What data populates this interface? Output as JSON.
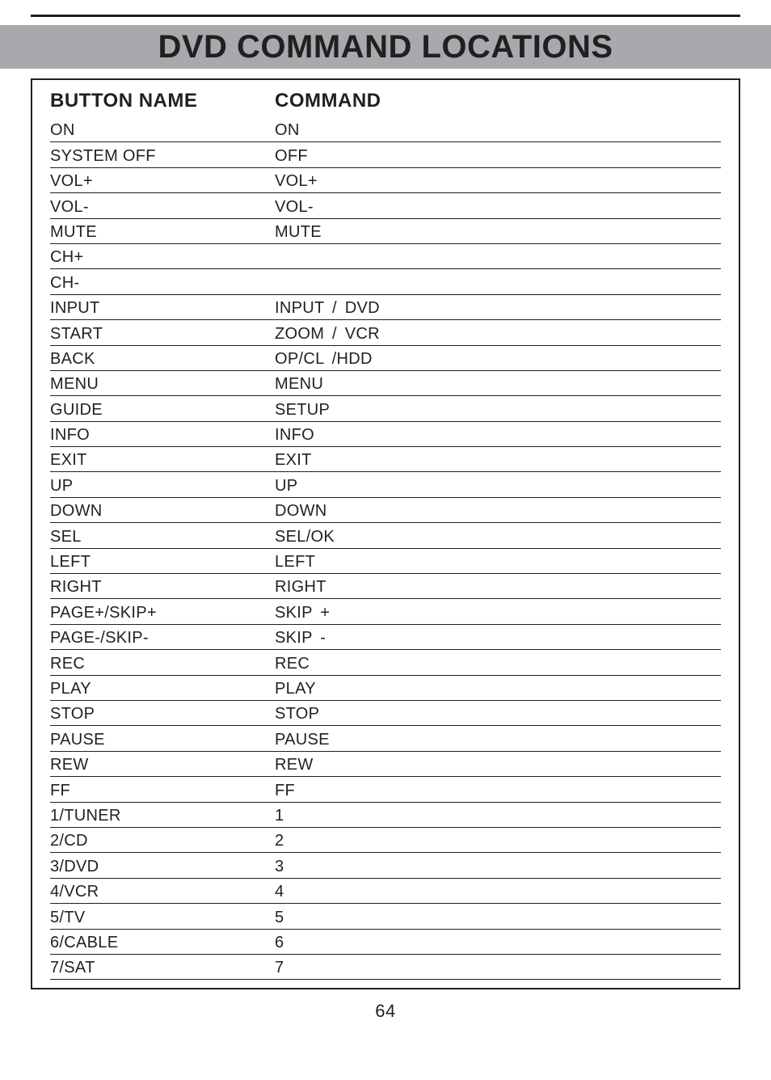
{
  "title": "DVD COMMAND LOCATIONS",
  "columns": {
    "name": "BUTTON NAME",
    "command": "COMMAND"
  },
  "rows": [
    {
      "name": "ON",
      "command": "ON"
    },
    {
      "name": "SYSTEM OFF",
      "command": "OFF"
    },
    {
      "name": "VOL+",
      "command": "VOL+"
    },
    {
      "name": "VOL-",
      "command": "VOL-"
    },
    {
      "name": "MUTE",
      "command": "MUTE"
    },
    {
      "name": "CH+",
      "command": ""
    },
    {
      "name": "CH-",
      "command": ""
    },
    {
      "name": "INPUT",
      "command": "INPUT  / DVD"
    },
    {
      "name": "START",
      "command": "ZOOM  / VCR"
    },
    {
      "name": "BACK",
      "command": "OP/CL  /HDD"
    },
    {
      "name": "MENU",
      "command": "MENU"
    },
    {
      "name": "GUIDE",
      "command": "SETUP"
    },
    {
      "name": "INFO",
      "command": "INFO"
    },
    {
      "name": "EXIT",
      "command": "EXIT"
    },
    {
      "name": "UP",
      "command": "UP"
    },
    {
      "name": "DOWN",
      "command": "DOWN"
    },
    {
      "name": "SEL",
      "command": "SEL/OK"
    },
    {
      "name": "LEFT",
      "command": "LEFT"
    },
    {
      "name": "RIGHT",
      "command": "RIGHT"
    },
    {
      "name": "PAGE+/SKIP+",
      "command": "SKIP +"
    },
    {
      "name": "PAGE-/SKIP-",
      "command": "SKIP -"
    },
    {
      "name": "REC",
      "command": "REC"
    },
    {
      "name": "PLAY",
      "command": "PLAY"
    },
    {
      "name": "STOP",
      "command": "STOP"
    },
    {
      "name": "PAUSE",
      "command": "PAUSE"
    },
    {
      "name": "REW",
      "command": "REW"
    },
    {
      "name": "FF",
      "command": "FF"
    },
    {
      "name": "1/TUNER",
      "command": "1"
    },
    {
      "name": "2/CD",
      "command": "2"
    },
    {
      "name": "3/DVD",
      "command": "3"
    },
    {
      "name": "4/VCR",
      "command": "4"
    },
    {
      "name": "5/TV",
      "command": "5"
    },
    {
      "name": "6/CABLE",
      "command": "6"
    },
    {
      "name": "7/SAT",
      "command": "7"
    }
  ],
  "page_number": "64"
}
